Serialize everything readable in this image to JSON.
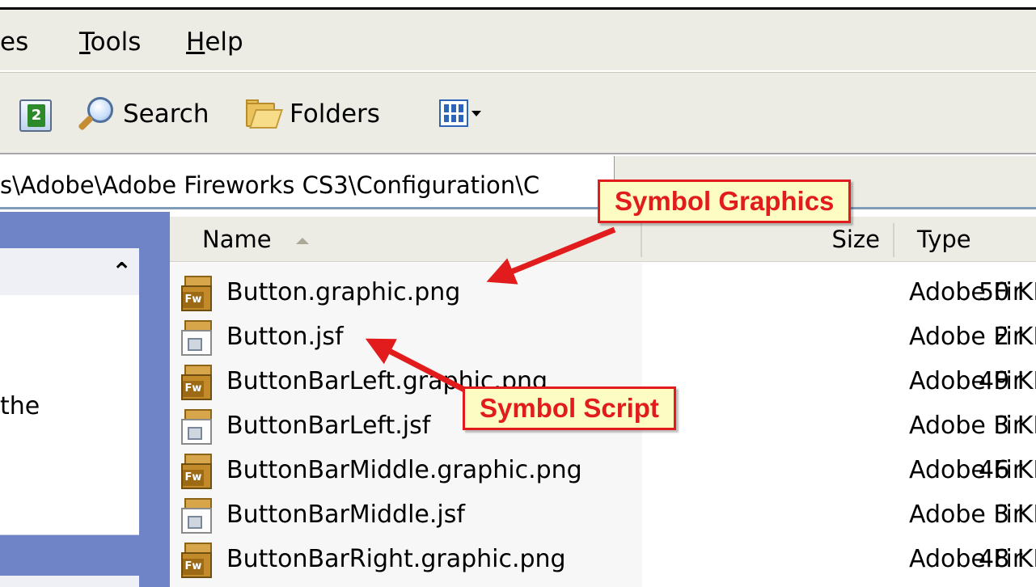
{
  "menu": {
    "partial_label": "es",
    "tools_label": "Tools",
    "tools_mnemonic": "T",
    "tools_rest": "ools",
    "help_label": "Help",
    "help_mnemonic": "H",
    "help_rest": "elp"
  },
  "toolbar": {
    "refresh_icon_glyph": "2",
    "search_label": "Search",
    "folders_label": "Folders"
  },
  "address": {
    "path": "s\\Adobe\\Adobe Fireworks CS3\\Configuration\\C"
  },
  "task_pane": {
    "collapse_glyph": "⌃",
    "partial_text": "the"
  },
  "list": {
    "columns": {
      "name": "Name",
      "size": "Size",
      "type": "Type"
    },
    "rows": [
      {
        "name": "Button.graphic.png",
        "size": "50 KB",
        "type": "Adobe Fir",
        "icon": "fireworks-png-icon"
      },
      {
        "name": "Button.jsf",
        "size": "2 KB",
        "type": "Adobe Fir",
        "icon": "jsf-script-icon"
      },
      {
        "name": "ButtonBarLeft.graphic.png",
        "size": "49 KB",
        "type": "Adobe Fir",
        "icon": "fireworks-png-icon"
      },
      {
        "name": "ButtonBarLeft.jsf",
        "size": "3 KB",
        "type": "Adobe Fir",
        "icon": "jsf-script-icon"
      },
      {
        "name": "ButtonBarMiddle.graphic.png",
        "size": "46 KB",
        "type": "Adobe Fir",
        "icon": "fireworks-png-icon"
      },
      {
        "name": "ButtonBarMiddle.jsf",
        "size": "3 KB",
        "type": "Adobe Fir",
        "icon": "jsf-script-icon"
      },
      {
        "name": "ButtonBarRight.graphic.png",
        "size": "48 KB",
        "type": "Adobe Fir",
        "icon": "fireworks-png-icon"
      }
    ]
  },
  "callouts": {
    "graphics": "Symbol Graphics",
    "script": "Symbol Script"
  },
  "colors": {
    "callout_border": "#e21c1c",
    "callout_fill": "#fdfcc2",
    "chrome": "#ecebe4"
  }
}
